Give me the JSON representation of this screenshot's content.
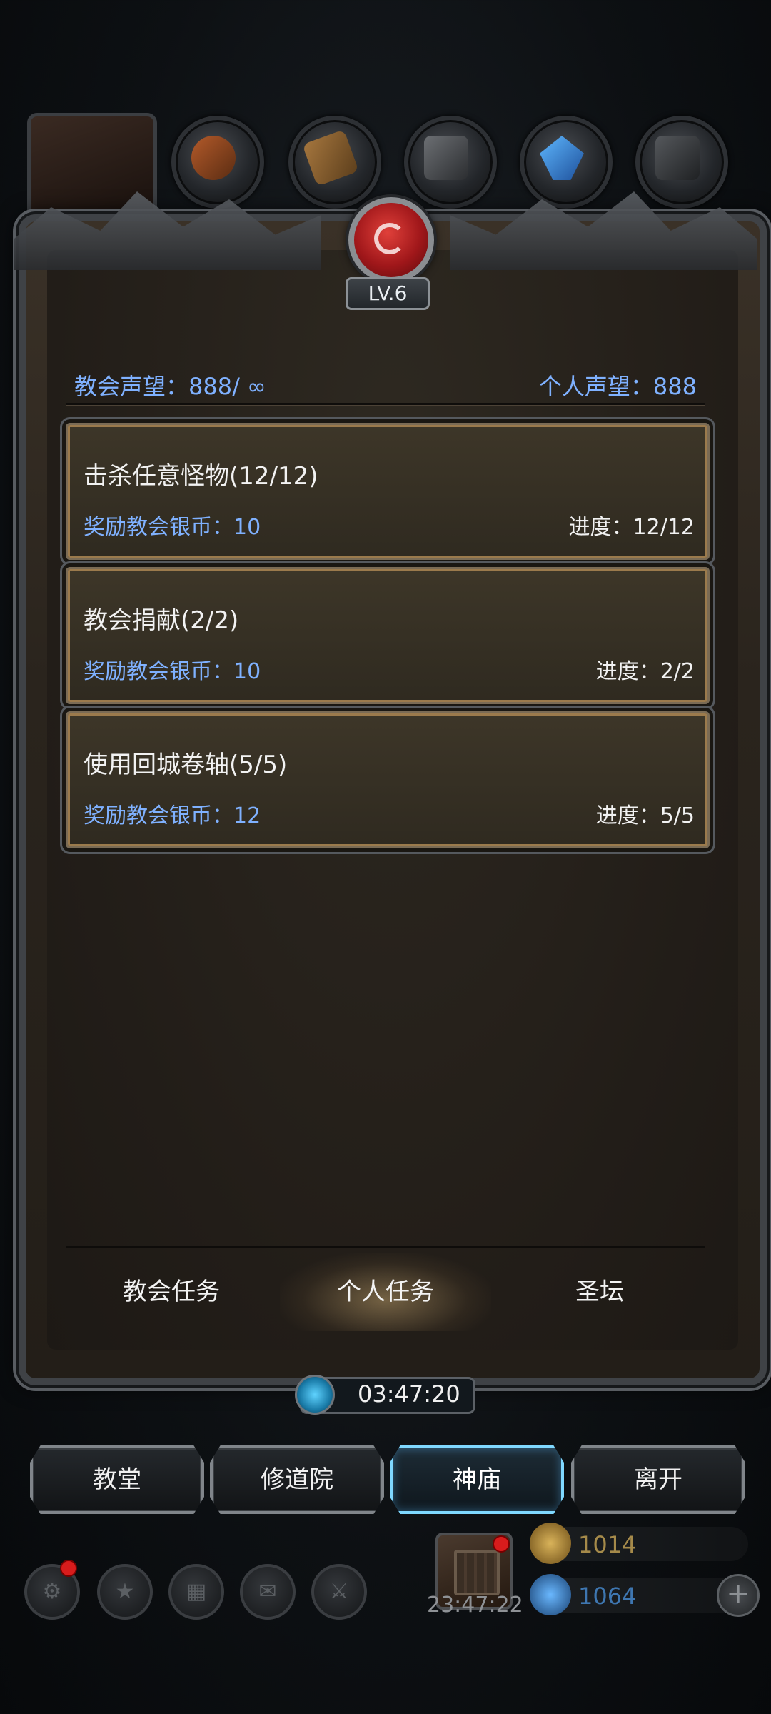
{
  "top_bar": {
    "resource_counts": [
      "",
      "",
      "",
      "",
      ""
    ]
  },
  "header": {
    "level": "LV.6",
    "church_reputation": "教会声望：888/ ∞",
    "personal_reputation": "个人声望：888"
  },
  "tasks": [
    {
      "title": "击杀任意怪物(12/12)",
      "reward": "奖励教会银币：10",
      "progress": "进度：12/12"
    },
    {
      "title": "教会捐献(2/2)",
      "reward": "奖励教会银币：10",
      "progress": "进度：2/2"
    },
    {
      "title": "使用回城卷轴(5/5)",
      "reward": "奖励教会银币：12",
      "progress": "进度：5/5"
    }
  ],
  "tabs": [
    {
      "label": "教会任务",
      "active": false
    },
    {
      "label": "个人任务",
      "active": true
    },
    {
      "label": "圣坛",
      "active": false
    }
  ],
  "timer": "03:47:20",
  "nav": [
    {
      "label": "教堂",
      "active": false
    },
    {
      "label": "修道院",
      "active": false
    },
    {
      "label": "神庙",
      "active": true
    },
    {
      "label": "离开",
      "active": false
    }
  ],
  "bottom": {
    "gift_timer": "23:47:22",
    "gold": "1014",
    "diamond": "1064"
  },
  "colors": {
    "reputation_text": "#7fb1ff",
    "active_nav_glow": "#4fc6ff",
    "gold": "#c9a34a",
    "diamond": "#4aa3ff"
  },
  "icons": [
    "settings-icon",
    "star-icon",
    "menu-icon",
    "mail-icon",
    "weapon-icon",
    "gift-icon",
    "gold-coin-icon",
    "diamond-icon",
    "plus-icon",
    "clock-icon"
  ]
}
